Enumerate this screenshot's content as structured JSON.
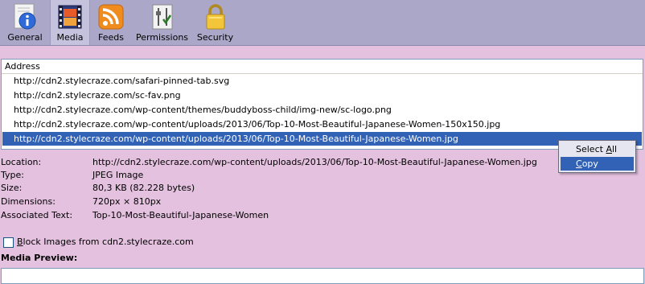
{
  "toolbar": {
    "tabs": [
      {
        "label": "General",
        "icon": "info-icon"
      },
      {
        "label": "Media",
        "icon": "media-icon",
        "selected": true
      },
      {
        "label": "Feeds",
        "icon": "rss-icon"
      },
      {
        "label": "Permissions",
        "icon": "permissions-icon"
      },
      {
        "label": "Security",
        "icon": "lock-icon"
      }
    ]
  },
  "list": {
    "header": "Address",
    "rows": [
      "http://cdn2.stylecraze.com/safari-pinned-tab.svg",
      "http://cdn2.stylecraze.com/sc-fav.png",
      "http://cdn2.stylecraze.com/wp-content/themes/buddyboss-child/img-new/sc-logo.png",
      "http://cdn2.stylecraze.com/wp-content/uploads/2013/06/Top-10-Most-Beautiful-Japanese-Women-150x150.jpg",
      "http://cdn2.stylecraze.com/wp-content/uploads/2013/06/Top-10-Most-Beautiful-Japanese-Women.jpg"
    ],
    "selected_index": 4
  },
  "context_menu": {
    "select_all_prefix": "Select ",
    "select_all_mnemonic": "A",
    "select_all_suffix": "ll",
    "copy_mnemonic": "C",
    "copy_suffix": "opy"
  },
  "details": {
    "location_label": "Location:",
    "location_value": "http://cdn2.stylecraze.com/wp-content/uploads/2013/06/Top-10-Most-Beautiful-Japanese-Women.jpg",
    "type_label": "Type:",
    "type_value": "JPEG Image",
    "size_label": "Size:",
    "size_value": "80,3 KB (82.228 bytes)",
    "dimensions_label": "Dimensions:",
    "dimensions_value": "720px × 810px",
    "assoc_label": "Associated Text:",
    "assoc_value": "Top-10-Most-Beautiful-Japanese-Women"
  },
  "block_images": {
    "mnemonic": "B",
    "label_rest": "lock Images from cdn2.stylecraze.com",
    "checked": false
  },
  "preview": {
    "title": "Media Preview:"
  },
  "colors": {
    "toolbar_bg": "#aba7c9",
    "window_bg": "#e4c1df",
    "selection": "#3162b5"
  }
}
